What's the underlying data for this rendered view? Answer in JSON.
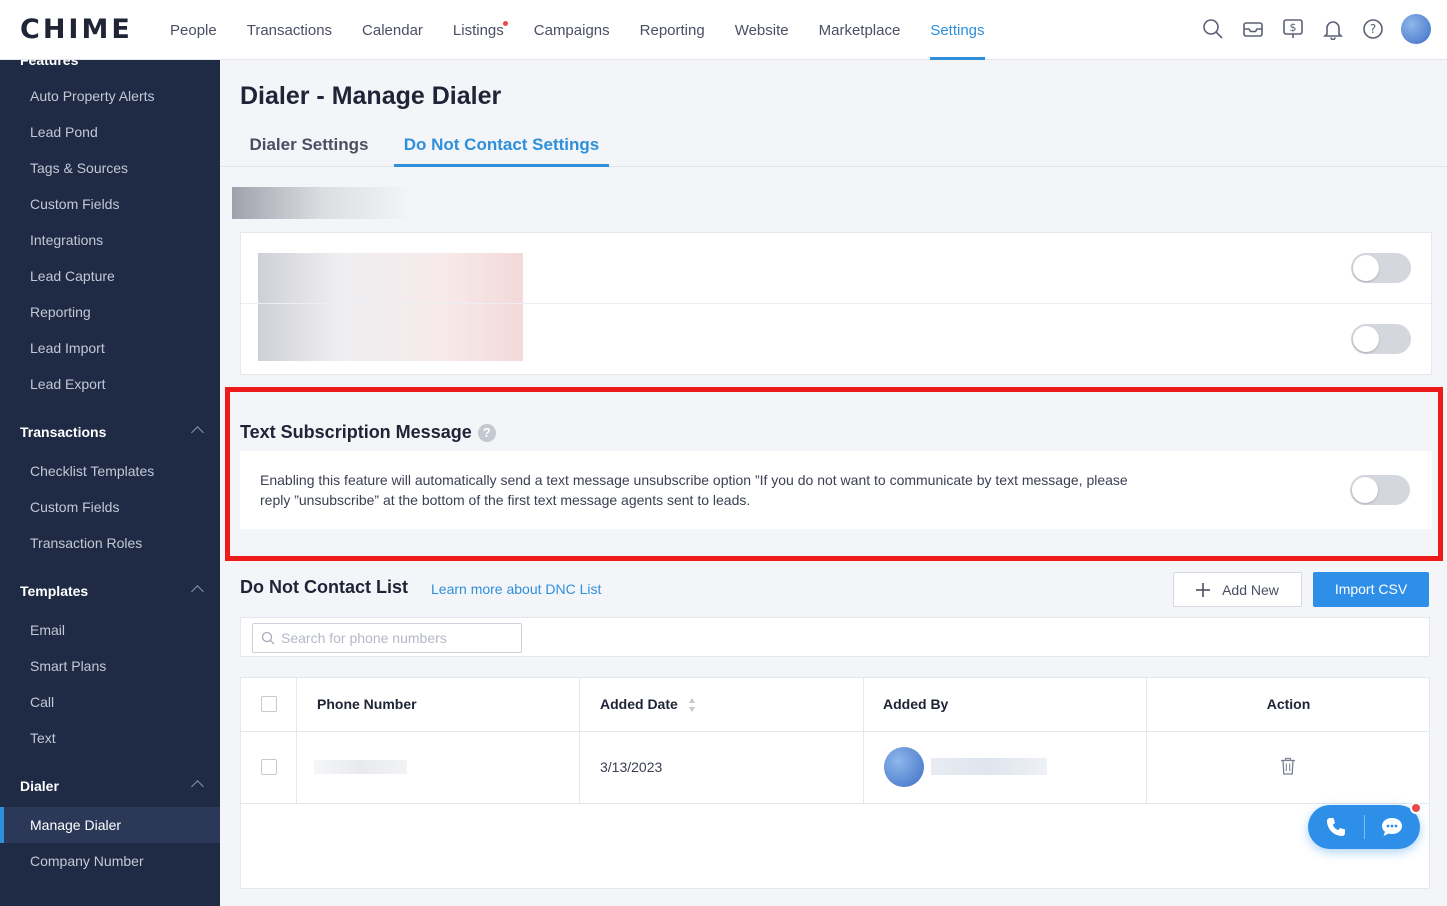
{
  "app": {
    "logo": "CHIME"
  },
  "nav": {
    "items": [
      {
        "label": "People"
      },
      {
        "label": "Transactions"
      },
      {
        "label": "Calendar"
      },
      {
        "label": "Listings"
      },
      {
        "label": "Campaigns"
      },
      {
        "label": "Reporting"
      },
      {
        "label": "Website"
      },
      {
        "label": "Marketplace"
      },
      {
        "label": "Settings"
      }
    ],
    "active": "Settings",
    "icons": [
      "search-icon",
      "inbox-icon",
      "billing-icon",
      "bell-icon",
      "help-icon",
      "avatar"
    ]
  },
  "sidebar": {
    "cut_heading": "Features",
    "features": [
      "Auto Property Alerts",
      "Lead Pond",
      "Tags & Sources",
      "Custom Fields",
      "Integrations",
      "Lead Capture",
      "Reporting",
      "Lead Import",
      "Lead Export"
    ],
    "transactions_heading": "Transactions",
    "transactions": [
      "Checklist Templates",
      "Custom Fields",
      "Transaction Roles"
    ],
    "templates_heading": "Templates",
    "templates": [
      "Email",
      "Smart Plans",
      "Call",
      "Text"
    ],
    "dialer_heading": "Dialer",
    "dialer": [
      "Manage Dialer",
      "Company Number"
    ],
    "active": "Manage Dialer"
  },
  "page": {
    "title": "Dialer - Manage Dialer",
    "tabs": [
      {
        "label": "Dialer Settings"
      },
      {
        "label": "Do Not Contact Settings"
      }
    ],
    "active_tab": "Do Not Contact Settings"
  },
  "text_subscription": {
    "title": "Text Subscription Message",
    "help": "?",
    "description": "Enabling this feature will automatically send a text message unsubscribe option ”If you do not want to communicate by text message, please reply ”unsubscribe” at the bottom of the first text message agents sent to leads.",
    "enabled": false
  },
  "dnc": {
    "title": "Do Not Contact List",
    "learn_more": "Learn more about DNC List",
    "add_new": "Add New",
    "import_csv": "Import CSV",
    "search_placeholder": "Search for phone numbers",
    "columns": [
      "Phone Number",
      "Added Date",
      "Added By",
      "Action"
    ],
    "rows": [
      {
        "added_date": "3/13/2023"
      }
    ]
  },
  "colors": {
    "accent": "#2e8fdb",
    "sidebar": "#1f2a44",
    "highlight": "#ee1b1b"
  }
}
